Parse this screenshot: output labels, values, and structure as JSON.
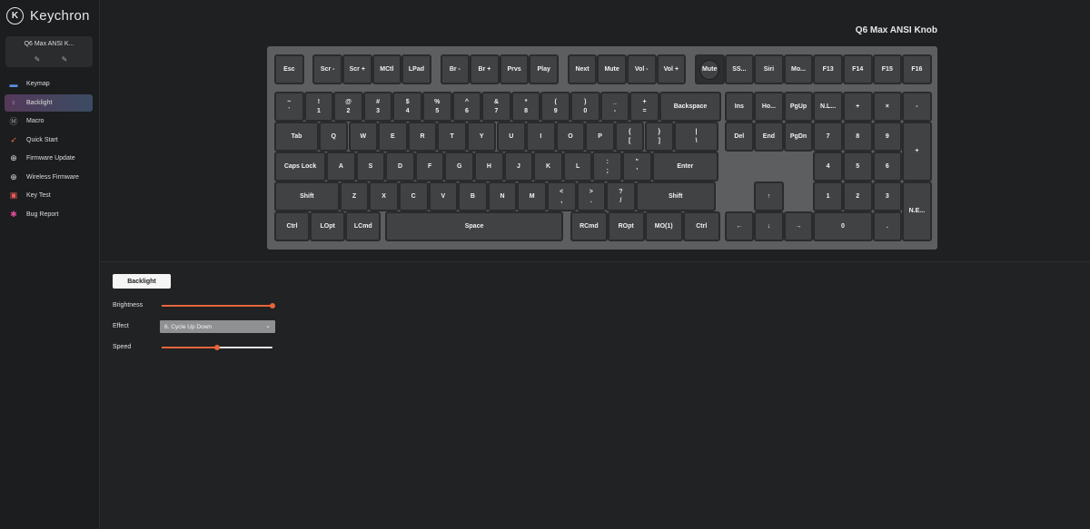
{
  "app": {
    "logo_glyph": "K",
    "logo_text": "Keychron"
  },
  "device": {
    "name": "Q6 Max ANSI K...",
    "tools": [
      "✎",
      "✎"
    ]
  },
  "nav": [
    {
      "label": "Keymap",
      "icon": "keyboard-icon",
      "glyph": "▬",
      "color": "#5b8de0"
    },
    {
      "label": "Backlight",
      "icon": "bulb-icon",
      "glyph": "♀",
      "color": "#c98de0"
    },
    {
      "label": "Macro",
      "icon": "macro-icon",
      "glyph": "Ⓜ",
      "color": "#999999"
    },
    {
      "label": "Quick Start",
      "icon": "rocket-icon",
      "glyph": "➶",
      "color": "#e8653a"
    },
    {
      "label": "Firmware Update",
      "icon": "firmware-icon",
      "glyph": "⊕",
      "color": "#dddddd"
    },
    {
      "label": "Wireless Firmware",
      "icon": "wireless-firmware-icon",
      "glyph": "⊕",
      "color": "#dddddd"
    },
    {
      "label": "Key Test",
      "icon": "key-test-icon",
      "glyph": "▣",
      "color": "#e85a5a"
    },
    {
      "label": "Bug Report",
      "icon": "bug-icon",
      "glyph": "✱",
      "color": "#e84a9a"
    }
  ],
  "active_nav": "Backlight",
  "keyboard_title": "Q6 Max ANSI Knob",
  "keys": {
    "row0": [
      "Esc",
      "Scr -",
      "Scr +",
      "MCtl",
      "LPad",
      "Br -",
      "Br +",
      "Prvs",
      "Play",
      "Next",
      "Mute",
      "Vol -",
      "Vol +",
      "Mute",
      "SS...",
      "Siri",
      "Mo...",
      "F13",
      "F14",
      "F15",
      "F16"
    ],
    "row1": [
      [
        "~",
        "`"
      ],
      [
        "!",
        "1"
      ],
      [
        "@",
        "2"
      ],
      [
        "#",
        "3"
      ],
      [
        "$",
        "4"
      ],
      [
        "%",
        "5"
      ],
      [
        "^",
        "6"
      ],
      [
        "&",
        "7"
      ],
      [
        "*",
        "8"
      ],
      [
        "(",
        "9"
      ],
      [
        ")",
        "0"
      ],
      [
        "_",
        "-"
      ],
      [
        "+",
        "="
      ],
      [
        "Backspace"
      ],
      [
        "Ins"
      ],
      [
        "Ho..."
      ],
      [
        "PgUp"
      ],
      [
        "N.L..."
      ],
      [
        "+"
      ],
      [
        "×"
      ],
      [
        "-"
      ]
    ],
    "row2": [
      [
        "Tab"
      ],
      [
        "Q"
      ],
      [
        "W"
      ],
      [
        "E"
      ],
      [
        "R"
      ],
      [
        "T"
      ],
      [
        "Y"
      ],
      [
        "U"
      ],
      [
        "I"
      ],
      [
        "O"
      ],
      [
        "P"
      ],
      [
        "{",
        "["
      ],
      [
        "}",
        "]"
      ],
      [
        "|",
        "\\"
      ],
      [
        "Del"
      ],
      [
        "End"
      ],
      [
        "PgDn"
      ],
      [
        "7"
      ],
      [
        "8"
      ],
      [
        "9"
      ],
      [
        "+"
      ]
    ],
    "row3": [
      [
        "Caps Lock"
      ],
      [
        "A"
      ],
      [
        "S"
      ],
      [
        "D"
      ],
      [
        "F"
      ],
      [
        "G"
      ],
      [
        "H"
      ],
      [
        "J"
      ],
      [
        "K"
      ],
      [
        "L"
      ],
      [
        ":",
        ";"
      ],
      [
        "\"",
        "'"
      ],
      [
        "Enter"
      ],
      [
        "4"
      ],
      [
        "5"
      ],
      [
        "6"
      ]
    ],
    "row4": [
      [
        "Shift"
      ],
      [
        "Z"
      ],
      [
        "X"
      ],
      [
        "C"
      ],
      [
        "V"
      ],
      [
        "B"
      ],
      [
        "N"
      ],
      [
        "M"
      ],
      [
        "<",
        ","
      ],
      [
        ">",
        "."
      ],
      [
        "?",
        "/"
      ],
      [
        "Shift"
      ],
      [
        "↑"
      ],
      [
        "1"
      ],
      [
        "2"
      ],
      [
        "3"
      ],
      [
        "N.E..."
      ]
    ],
    "row5": [
      [
        "Ctrl"
      ],
      [
        "LOpt"
      ],
      [
        "LCmd"
      ],
      [
        "Space"
      ],
      [
        "RCmd"
      ],
      [
        "ROpt"
      ],
      [
        "MO(1)"
      ],
      [
        "Ctrl"
      ],
      [
        "←"
      ],
      [
        "↓"
      ],
      [
        "→"
      ],
      [
        "0"
      ],
      [
        "."
      ]
    ]
  },
  "panel": {
    "tab_label": "Backlight",
    "brightness_label": "Brightness",
    "brightness_value": 1.0,
    "effect_label": "Effect",
    "effect_value": "6. Cycle Up Down",
    "speed_label": "Speed",
    "speed_value": 0.5,
    "accent": "#e8653a"
  }
}
